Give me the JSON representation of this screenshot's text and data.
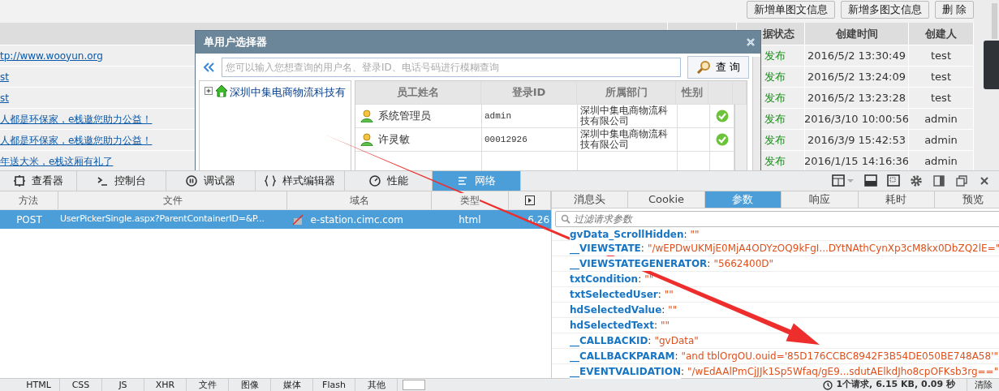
{
  "page": {
    "toolbar_buttons": [
      "新增单图文信息",
      "新增多图文信息",
      "删 除"
    ],
    "table": {
      "columns": [
        "据状态",
        "创建时间",
        "创建人"
      ],
      "rows": [
        {
          "title": "tp://www.wooyun.org",
          "status": "发布",
          "created": "2016/5/2 13:30:49",
          "creator": "test"
        },
        {
          "title": "st",
          "status": "发布",
          "created": "2016/5/2 13:24:09",
          "creator": "test"
        },
        {
          "title": "st",
          "status": "发布",
          "created": "2016/5/2 13:23:28",
          "creator": "test"
        },
        {
          "title": "人都是环保家，e栈邀您助力公益！",
          "status": "发布",
          "created": "2016/3/10 10:00:56",
          "creator": "admin"
        },
        {
          "title": "人都是环保家，e栈邀您助力公益！",
          "status": "发布",
          "created": "2016/3/9 15:42:53",
          "creator": "admin"
        },
        {
          "title": "年送大米，e栈这厢有礼了",
          "status": "发布",
          "created": "2016/1/15 14:16:36",
          "creator": "admin"
        }
      ]
    }
  },
  "dialog": {
    "title": "单用户选择器",
    "search": {
      "placeholder": "您可以输入您想查询的用户名、登录ID、电话号码进行模糊查询"
    },
    "query_button": "查 询",
    "tree": {
      "label": "深圳中集电商物流科技有",
      "expanded": false
    },
    "grid": {
      "columns": [
        "员工姓名",
        "登录ID",
        "所属部门",
        "性别"
      ],
      "rows": [
        {
          "name": "系统管理员",
          "login_id": "admin",
          "department": "深圳中集电商物流科技有限公司",
          "checked": true
        },
        {
          "name": "许灵敏",
          "login_id": "00012926",
          "department": "深圳中集电商物流科技有限公司",
          "checked": true
        }
      ]
    }
  },
  "devtools": {
    "tabs": [
      {
        "label": "查看器",
        "selected": false
      },
      {
        "label": "控制台",
        "selected": false
      },
      {
        "label": "调试器",
        "selected": false
      },
      {
        "label": "样式编辑器",
        "selected": false
      },
      {
        "label": "性能",
        "selected": false
      },
      {
        "label": "网络",
        "selected": true
      }
    ],
    "requests": {
      "columns": [
        "方法",
        "文件",
        "域名",
        "类型"
      ],
      "rows": [
        {
          "method": "POST",
          "file": "UserPickerSingle.aspx?ParentContainerID=&P...",
          "domain": "e-station.cimc.com",
          "type": "html",
          "size": "6.26",
          "selected": true
        }
      ]
    },
    "detail_tabs": [
      {
        "label": "消息头",
        "selected": false
      },
      {
        "label": "Cookie",
        "selected": false
      },
      {
        "label": "参数",
        "selected": true
      },
      {
        "label": "响应",
        "selected": false
      },
      {
        "label": "耗时",
        "selected": false
      },
      {
        "label": "预览",
        "selected": false
      }
    ],
    "filter": {
      "placeholder": "过滤请求参数"
    },
    "params": [
      {
        "key": "gvData_ScrollHidden",
        "sep": ":",
        "value": "\"\""
      },
      {
        "key": "__VIEWSTATE",
        "sep": ":",
        "value": "\"/wEPDwUKMjE0MjA4ODYzOQ9kFgI...DYtNAthCynXp3cM8kx0DbZQ2lE=\""
      },
      {
        "key": "__VIEWSTATEGENERATOR",
        "sep": ":",
        "value": "\"5662400D\""
      },
      {
        "key": "txtCondition",
        "sep": ":",
        "value": "\"\""
      },
      {
        "key": "txtSelectedUser",
        "sep": ":",
        "value": "\"\""
      },
      {
        "key": "hdSelectedValue",
        "sep": ":",
        "value": "\"\""
      },
      {
        "key": "hdSelectedText",
        "sep": ":",
        "value": "\"\""
      },
      {
        "key": "__CALLBACKID",
        "sep": ":",
        "value": "\"gvData\""
      },
      {
        "key": "__CALLBACKPARAM",
        "sep": ":",
        "value": "\"and tblOrgOU.ouid='85D176CCBC8942F3B54DE050BE748A58'\""
      },
      {
        "key": "__EVENTVALIDATION",
        "sep": ":",
        "value": "\"/wEdAAlPmCjJJk1Sp5Wfaq/gE9...sdutAElkdJho8cpOFKsb3rg==\""
      }
    ],
    "type_filters": [
      "HTML",
      "CSS",
      "JS",
      "XHR",
      "文件",
      "图像",
      "媒体",
      "Flash",
      "其他"
    ],
    "summary": "1个请求, 6.15 KB, 0.09 秒",
    "clear_button": "清除"
  }
}
